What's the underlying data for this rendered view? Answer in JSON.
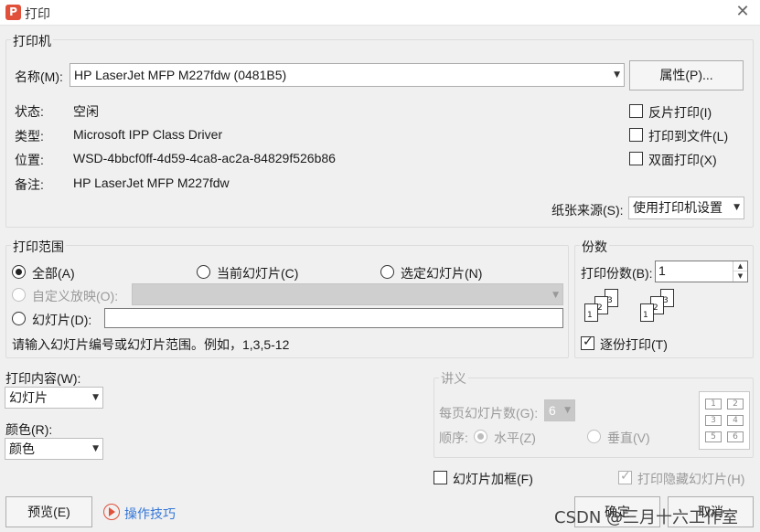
{
  "window": {
    "title": "打印",
    "app_icon": "P"
  },
  "printer": {
    "group_label": "打印机",
    "name_label": "名称(M):",
    "name_value": "HP LaserJet MFP M227fdw (0481B5)",
    "properties_button": "属性(P)...",
    "status_label": "状态:",
    "status_value": "空闲",
    "type_label": "类型:",
    "type_value": "Microsoft IPP Class Driver",
    "location_label": "位置:",
    "location_value": "WSD-4bbcf0ff-4d59-4ca8-ac2a-84829f526b86",
    "comment_label": "备注:",
    "comment_value": "HP LaserJet MFP M227fdw",
    "reverse_print": "反片打印(I)",
    "print_to_file": "打印到文件(L)",
    "duplex": "双面打印(X)",
    "paper_source_label": "纸张来源(S):",
    "paper_source_value": "使用打印机设置"
  },
  "range": {
    "group_label": "打印范围",
    "all": "全部(A)",
    "current_slide": "当前幻灯片(C)",
    "selected_slides": "选定幻灯片(N)",
    "custom_show": "自定义放映(O):",
    "slides": "幻灯片(D):",
    "slides_value": "",
    "hint": "请输入幻灯片编号或幻灯片范围。例如，1,3,5-12"
  },
  "copies": {
    "group_label": "份数",
    "count_label": "打印份数(B):",
    "count_value": "1",
    "collate": "逐份打印(T)",
    "pages_set1": [
      "1",
      "2",
      "3"
    ],
    "pages_set2": [
      "1",
      "2",
      "3"
    ]
  },
  "content": {
    "print_what_label": "打印内容(W):",
    "print_what_value": "幻灯片",
    "color_label": "颜色(R):",
    "color_value": "颜色"
  },
  "handout": {
    "group_label": "讲义",
    "per_page_label": "每页幻灯片数(G):",
    "per_page_value": "6",
    "order_label": "顺序:",
    "horizontal": "水平(Z)",
    "vertical": "垂直(V)",
    "cells": [
      "1",
      "2",
      "3",
      "4",
      "5",
      "6"
    ]
  },
  "options": {
    "frame_slides": "幻灯片加框(F)",
    "print_hidden": "打印隐藏幻灯片(H)"
  },
  "footer": {
    "preview_button": "预览(E)",
    "tips_link": "操作技巧",
    "ok_button": "确定",
    "cancel_button": "取消",
    "watermark": "CSDN @三月十六工作室"
  },
  "icons": {
    "app": "presentation-app-icon",
    "close": "close-icon",
    "tips": "play-circle-icon"
  },
  "colors": {
    "accent": "#e0503a",
    "link": "#3477d8"
  }
}
